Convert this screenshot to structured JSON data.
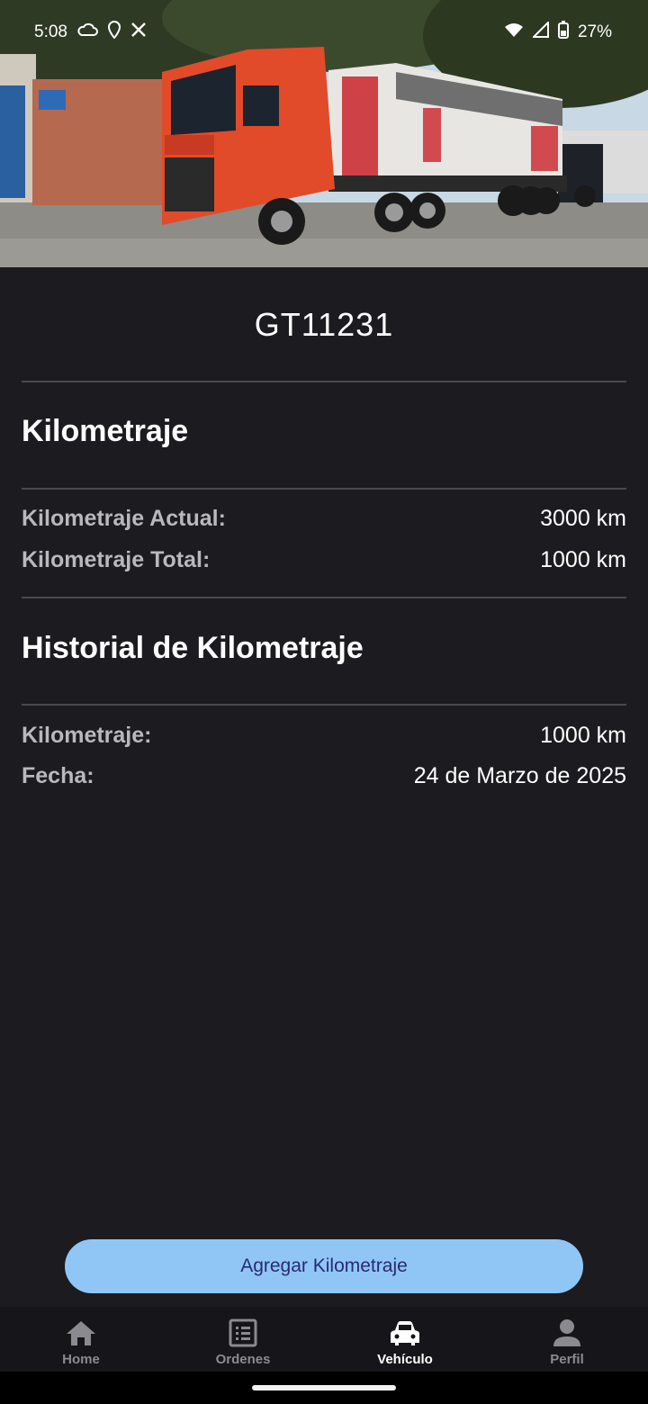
{
  "status_bar": {
    "time": "5:08",
    "battery": "27%",
    "icons": [
      "cloud-icon",
      "location-icon",
      "x-app-icon",
      "wifi-icon",
      "cell-signal-icon",
      "battery-icon"
    ]
  },
  "vehicle": {
    "plate": "GT11231"
  },
  "mileage": {
    "heading": "Kilometraje",
    "current_label": "Kilometraje Actual:",
    "current_value": "3000 km",
    "total_label": "Kilometraje Total:",
    "total_value": "1000 km"
  },
  "history": {
    "heading": "Historial de Kilometraje",
    "entries": [
      {
        "km_label": "Kilometraje:",
        "km_value": "1000 km",
        "date_label": "Fecha:",
        "date_value": "24 de Marzo de 2025"
      }
    ]
  },
  "actions": {
    "add_mileage": "Agregar Kilometraje"
  },
  "bottom_nav": {
    "items": [
      {
        "label": "Home",
        "icon": "home-icon",
        "active": false
      },
      {
        "label": "Ordenes",
        "icon": "list-icon",
        "active": false
      },
      {
        "label": "Vehículo",
        "icon": "car-icon",
        "active": true
      },
      {
        "label": "Perfil",
        "icon": "person-icon",
        "active": false
      }
    ]
  },
  "colors": {
    "background": "#1c1b1f",
    "button": "#8fc6f6",
    "button_text": "#2a2a72",
    "nav_inactive": "#8b8a90"
  }
}
